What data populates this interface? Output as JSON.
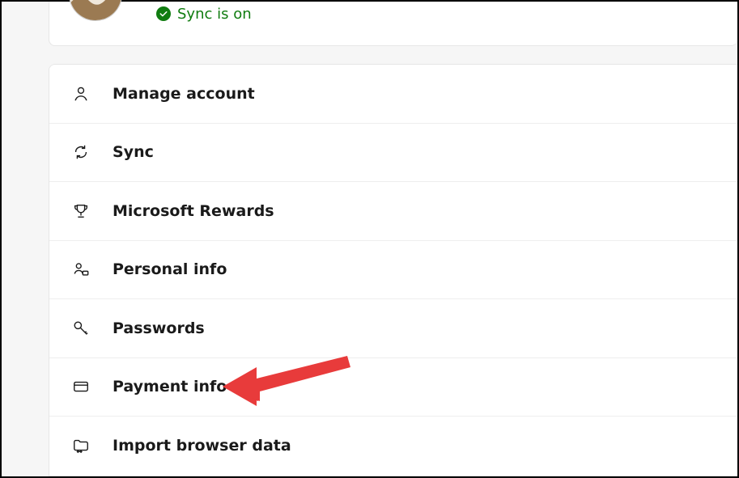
{
  "profile": {
    "sync_status": "Sync is on"
  },
  "menu": {
    "items": [
      {
        "key": "manage-account",
        "label": "Manage account",
        "icon": "person-icon"
      },
      {
        "key": "sync",
        "label": "Sync",
        "icon": "sync-icon"
      },
      {
        "key": "microsoft-rewards",
        "label": "Microsoft Rewards",
        "icon": "trophy-icon"
      },
      {
        "key": "personal-info",
        "label": "Personal info",
        "icon": "person-card-icon"
      },
      {
        "key": "passwords",
        "label": "Passwords",
        "icon": "key-icon"
      },
      {
        "key": "payment-info",
        "label": "Payment info",
        "icon": "credit-card-icon"
      },
      {
        "key": "import-browser-data",
        "label": "Import browser data",
        "icon": "folder-arrow-icon"
      }
    ]
  },
  "annotation": {
    "arrow_color": "#e83b3b",
    "target": "payment-info"
  },
  "colors": {
    "accent_green": "#107c10",
    "text": "#1a1a1a",
    "border": "#e6e6e6"
  }
}
